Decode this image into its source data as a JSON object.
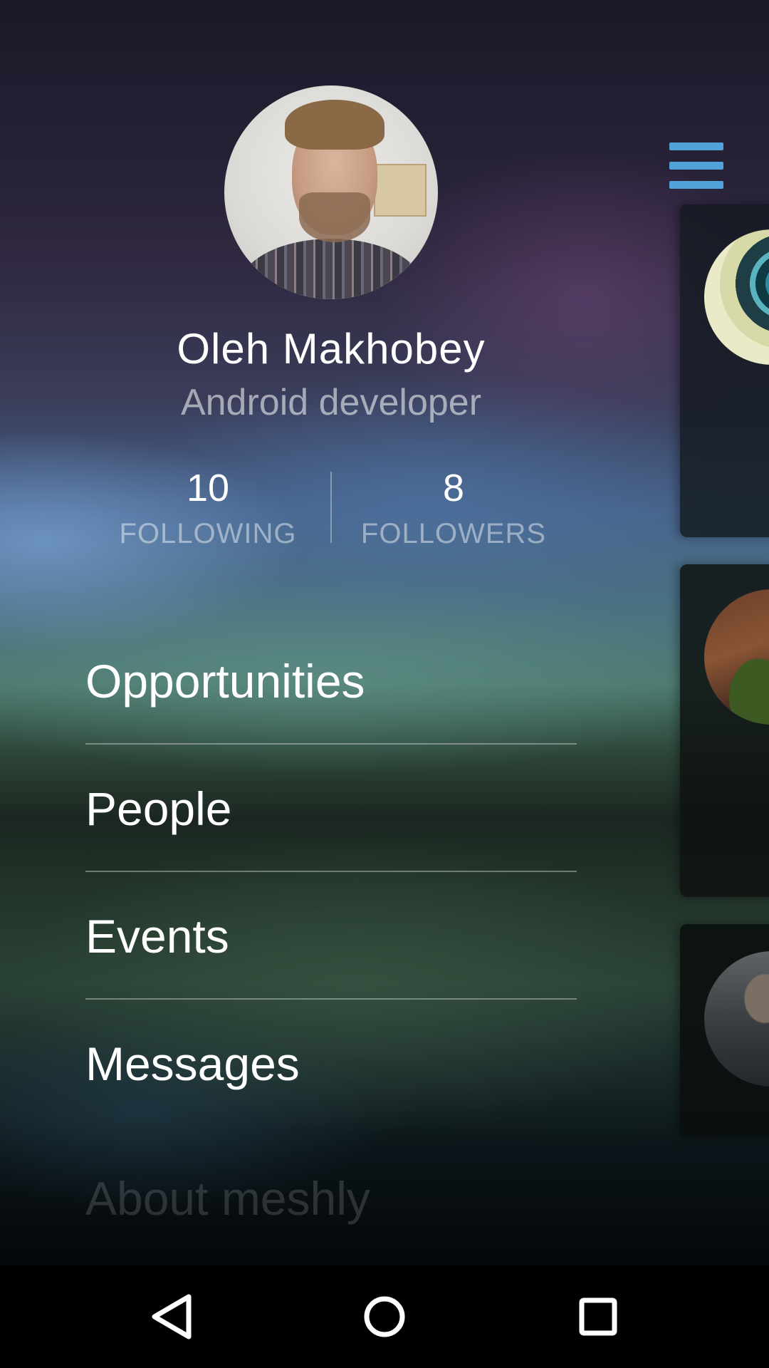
{
  "profile": {
    "name": "Oleh Makhobey",
    "role": "Android developer",
    "avatar_icon": "user-photo"
  },
  "stats": {
    "following": {
      "count": "10",
      "label": "FOLLOWING"
    },
    "followers": {
      "count": "8",
      "label": "FOLLOWERS"
    }
  },
  "menu": {
    "items": [
      {
        "label": "Opportunities"
      },
      {
        "label": "People"
      },
      {
        "label": "Events"
      },
      {
        "label": "Messages"
      },
      {
        "label": "About meshly"
      }
    ]
  },
  "header": {
    "menu_icon": "hamburger-menu-icon",
    "accent_color": "#4fa3d8"
  },
  "navbar": {
    "back_icon": "back-triangle-icon",
    "home_icon": "home-circle-icon",
    "recent_icon": "recent-apps-square-icon"
  }
}
